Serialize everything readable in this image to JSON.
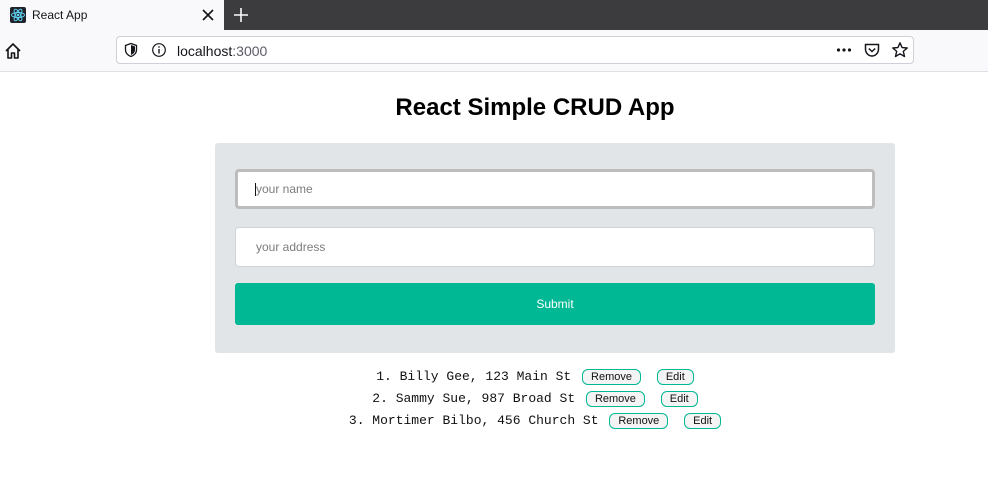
{
  "browser": {
    "tab_title": "React App",
    "url_host": "localhost",
    "url_port": ":3000"
  },
  "icons": {
    "favicon": "react-logo-icon",
    "tab_close": "close-icon",
    "new_tab": "plus-icon",
    "home": "home-icon",
    "tracking": "shield-icon",
    "site_info": "info-icon",
    "page_actions": "more-horizontal-icon",
    "pocket": "pocket-icon",
    "bookmark": "star-icon"
  },
  "colors": {
    "accent": "#00b894",
    "card_background": "#e1e5e8"
  },
  "page": {
    "title": "React Simple CRUD App"
  },
  "form": {
    "name_placeholder": "your name",
    "address_placeholder": "your address",
    "submit_label": "Submit"
  },
  "people": [
    {
      "text": "1. Billy Gee, 123 Main St",
      "remove_label": "Remove",
      "edit_label": "Edit"
    },
    {
      "text": "2. Sammy Sue, 987 Broad St",
      "remove_label": "Remove",
      "edit_label": "Edit"
    },
    {
      "text": "3. Mortimer Bilbo, 456 Church St",
      "remove_label": "Remove",
      "edit_label": "Edit"
    }
  ]
}
